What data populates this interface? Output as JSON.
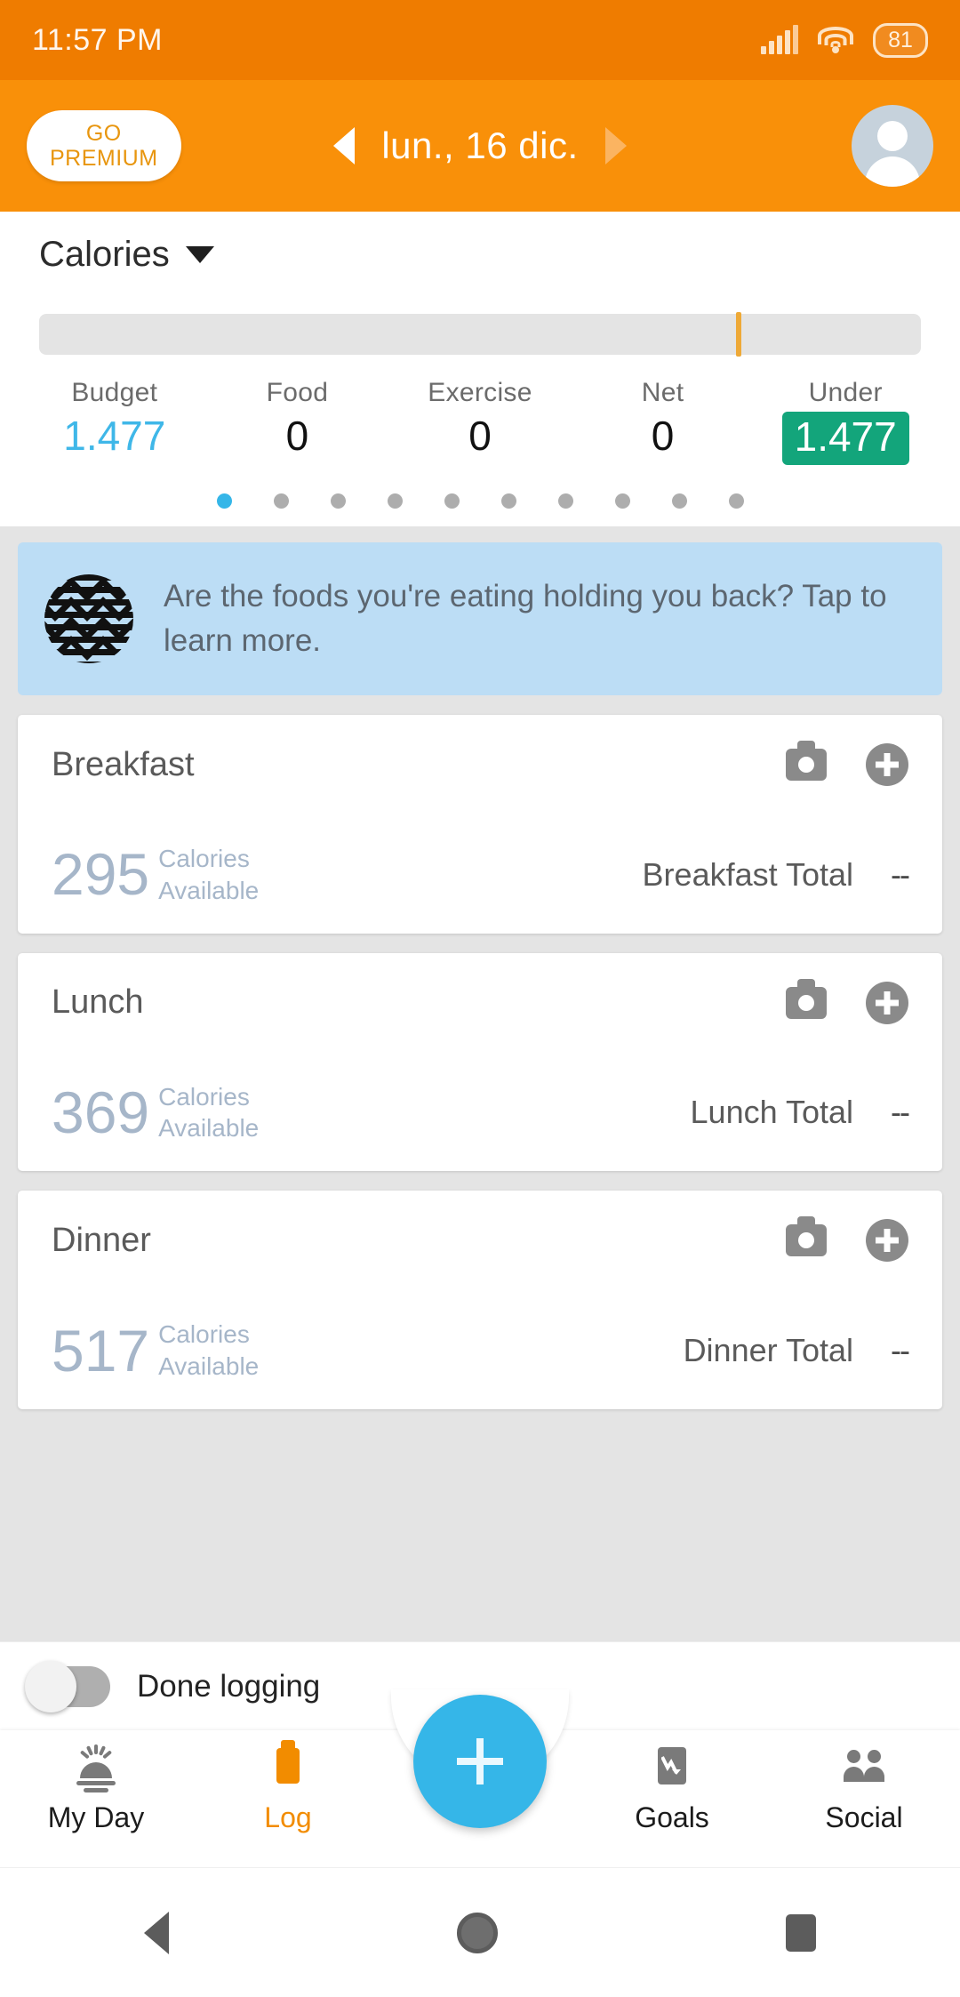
{
  "status_bar": {
    "time": "11:57 PM",
    "signal_icon": "signal-bars-icon",
    "wifi_icon": "wifi-icon",
    "battery_level": "81"
  },
  "app_bar": {
    "premium_line1": "GO",
    "premium_line2": "PREMIUM",
    "prev_day_icon": "chevron-left-icon",
    "date": "lun., 16 dic.",
    "next_day_icon": "chevron-right-icon",
    "avatar_icon": "user-avatar-icon"
  },
  "summary": {
    "selector_label": "Calories",
    "selector_icon": "chevron-down-icon",
    "progress_marker_percent": 79,
    "stats": [
      {
        "label": "Budget",
        "value": "1.477",
        "style": "budget"
      },
      {
        "label": "Food",
        "value": "0",
        "style": "plain"
      },
      {
        "label": "Exercise",
        "value": "0",
        "style": "plain"
      },
      {
        "label": "Net",
        "value": "0",
        "style": "plain"
      },
      {
        "label": "Under",
        "value": "1.477",
        "style": "under"
      }
    ],
    "page_dots": 10,
    "active_dot": 1
  },
  "banner": {
    "icon": "zigzag-circle-icon",
    "text": "Are the foods you're eating holding you back? Tap to learn more."
  },
  "meals": [
    {
      "name": "Breakfast",
      "camera_icon": "camera-icon",
      "add_icon": "plus-circle-icon",
      "available_number": "295",
      "available_label_1": "Calories",
      "available_label_2": "Available",
      "total_label": "Breakfast Total",
      "total_value": "--"
    },
    {
      "name": "Lunch",
      "camera_icon": "camera-icon",
      "add_icon": "plus-circle-icon",
      "available_number": "369",
      "available_label_1": "Calories",
      "available_label_2": "Available",
      "total_label": "Lunch Total",
      "total_value": "--"
    },
    {
      "name": "Dinner",
      "camera_icon": "camera-icon",
      "add_icon": "plus-circle-icon",
      "available_number": "517",
      "available_label_1": "Calories",
      "available_label_2": "Available",
      "total_label": "Dinner Total",
      "total_value": "--"
    }
  ],
  "done_logging": {
    "label": "Done logging",
    "toggle_state": "off"
  },
  "fab": {
    "icon": "plus-icon"
  },
  "bottom_nav": {
    "items": [
      {
        "label": "My Day",
        "icon": "sunrise-icon",
        "active": false
      },
      {
        "label": "Log",
        "icon": "clipboard-icon",
        "active": true
      },
      {
        "label": "Goals",
        "icon": "trend-down-chart-icon",
        "active": false
      },
      {
        "label": "Social",
        "icon": "people-icon",
        "active": false
      }
    ]
  },
  "android_nav": {
    "back_icon": "triangle-back-icon",
    "home_icon": "circle-home-icon",
    "recents_icon": "square-recents-icon"
  },
  "colors": {
    "status_bar": "#EF7C00",
    "app_bar": "#F99009",
    "accent_blue": "#35B6E8",
    "under_green": "#13A57B",
    "log_orange": "#F28C00",
    "banner_blue": "#BCDDF5",
    "page_bg": "#E4E4E4"
  }
}
